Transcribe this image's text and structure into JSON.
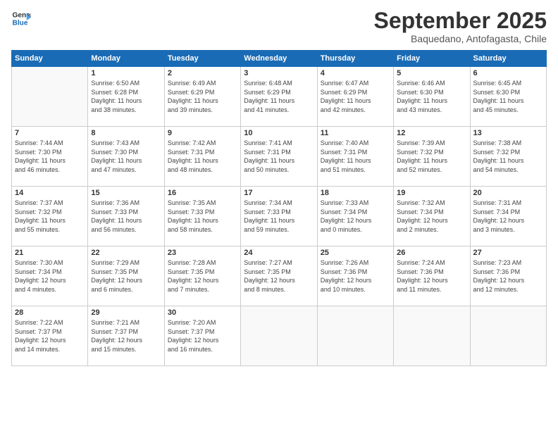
{
  "logo": {
    "line1": "General",
    "line2": "Blue"
  },
  "title": "September 2025",
  "subtitle": "Baquedano, Antofagasta, Chile",
  "weekdays": [
    "Sunday",
    "Monday",
    "Tuesday",
    "Wednesday",
    "Thursday",
    "Friday",
    "Saturday"
  ],
  "weeks": [
    [
      {
        "day": "",
        "content": ""
      },
      {
        "day": "1",
        "content": "Sunrise: 6:50 AM\nSunset: 6:28 PM\nDaylight: 11 hours\nand 38 minutes."
      },
      {
        "day": "2",
        "content": "Sunrise: 6:49 AM\nSunset: 6:29 PM\nDaylight: 11 hours\nand 39 minutes."
      },
      {
        "day": "3",
        "content": "Sunrise: 6:48 AM\nSunset: 6:29 PM\nDaylight: 11 hours\nand 41 minutes."
      },
      {
        "day": "4",
        "content": "Sunrise: 6:47 AM\nSunset: 6:29 PM\nDaylight: 11 hours\nand 42 minutes."
      },
      {
        "day": "5",
        "content": "Sunrise: 6:46 AM\nSunset: 6:30 PM\nDaylight: 11 hours\nand 43 minutes."
      },
      {
        "day": "6",
        "content": "Sunrise: 6:45 AM\nSunset: 6:30 PM\nDaylight: 11 hours\nand 45 minutes."
      }
    ],
    [
      {
        "day": "7",
        "content": "Sunrise: 7:44 AM\nSunset: 7:30 PM\nDaylight: 11 hours\nand 46 minutes."
      },
      {
        "day": "8",
        "content": "Sunrise: 7:43 AM\nSunset: 7:30 PM\nDaylight: 11 hours\nand 47 minutes."
      },
      {
        "day": "9",
        "content": "Sunrise: 7:42 AM\nSunset: 7:31 PM\nDaylight: 11 hours\nand 48 minutes."
      },
      {
        "day": "10",
        "content": "Sunrise: 7:41 AM\nSunset: 7:31 PM\nDaylight: 11 hours\nand 50 minutes."
      },
      {
        "day": "11",
        "content": "Sunrise: 7:40 AM\nSunset: 7:31 PM\nDaylight: 11 hours\nand 51 minutes."
      },
      {
        "day": "12",
        "content": "Sunrise: 7:39 AM\nSunset: 7:32 PM\nDaylight: 11 hours\nand 52 minutes."
      },
      {
        "day": "13",
        "content": "Sunrise: 7:38 AM\nSunset: 7:32 PM\nDaylight: 11 hours\nand 54 minutes."
      }
    ],
    [
      {
        "day": "14",
        "content": "Sunrise: 7:37 AM\nSunset: 7:32 PM\nDaylight: 11 hours\nand 55 minutes."
      },
      {
        "day": "15",
        "content": "Sunrise: 7:36 AM\nSunset: 7:33 PM\nDaylight: 11 hours\nand 56 minutes."
      },
      {
        "day": "16",
        "content": "Sunrise: 7:35 AM\nSunset: 7:33 PM\nDaylight: 11 hours\nand 58 minutes."
      },
      {
        "day": "17",
        "content": "Sunrise: 7:34 AM\nSunset: 7:33 PM\nDaylight: 11 hours\nand 59 minutes."
      },
      {
        "day": "18",
        "content": "Sunrise: 7:33 AM\nSunset: 7:34 PM\nDaylight: 12 hours\nand 0 minutes."
      },
      {
        "day": "19",
        "content": "Sunrise: 7:32 AM\nSunset: 7:34 PM\nDaylight: 12 hours\nand 2 minutes."
      },
      {
        "day": "20",
        "content": "Sunrise: 7:31 AM\nSunset: 7:34 PM\nDaylight: 12 hours\nand 3 minutes."
      }
    ],
    [
      {
        "day": "21",
        "content": "Sunrise: 7:30 AM\nSunset: 7:34 PM\nDaylight: 12 hours\nand 4 minutes."
      },
      {
        "day": "22",
        "content": "Sunrise: 7:29 AM\nSunset: 7:35 PM\nDaylight: 12 hours\nand 6 minutes."
      },
      {
        "day": "23",
        "content": "Sunrise: 7:28 AM\nSunset: 7:35 PM\nDaylight: 12 hours\nand 7 minutes."
      },
      {
        "day": "24",
        "content": "Sunrise: 7:27 AM\nSunset: 7:35 PM\nDaylight: 12 hours\nand 8 minutes."
      },
      {
        "day": "25",
        "content": "Sunrise: 7:26 AM\nSunset: 7:36 PM\nDaylight: 12 hours\nand 10 minutes."
      },
      {
        "day": "26",
        "content": "Sunrise: 7:24 AM\nSunset: 7:36 PM\nDaylight: 12 hours\nand 11 minutes."
      },
      {
        "day": "27",
        "content": "Sunrise: 7:23 AM\nSunset: 7:36 PM\nDaylight: 12 hours\nand 12 minutes."
      }
    ],
    [
      {
        "day": "28",
        "content": "Sunrise: 7:22 AM\nSunset: 7:37 PM\nDaylight: 12 hours\nand 14 minutes."
      },
      {
        "day": "29",
        "content": "Sunrise: 7:21 AM\nSunset: 7:37 PM\nDaylight: 12 hours\nand 15 minutes."
      },
      {
        "day": "30",
        "content": "Sunrise: 7:20 AM\nSunset: 7:37 PM\nDaylight: 12 hours\nand 16 minutes."
      },
      {
        "day": "",
        "content": ""
      },
      {
        "day": "",
        "content": ""
      },
      {
        "day": "",
        "content": ""
      },
      {
        "day": "",
        "content": ""
      }
    ]
  ]
}
